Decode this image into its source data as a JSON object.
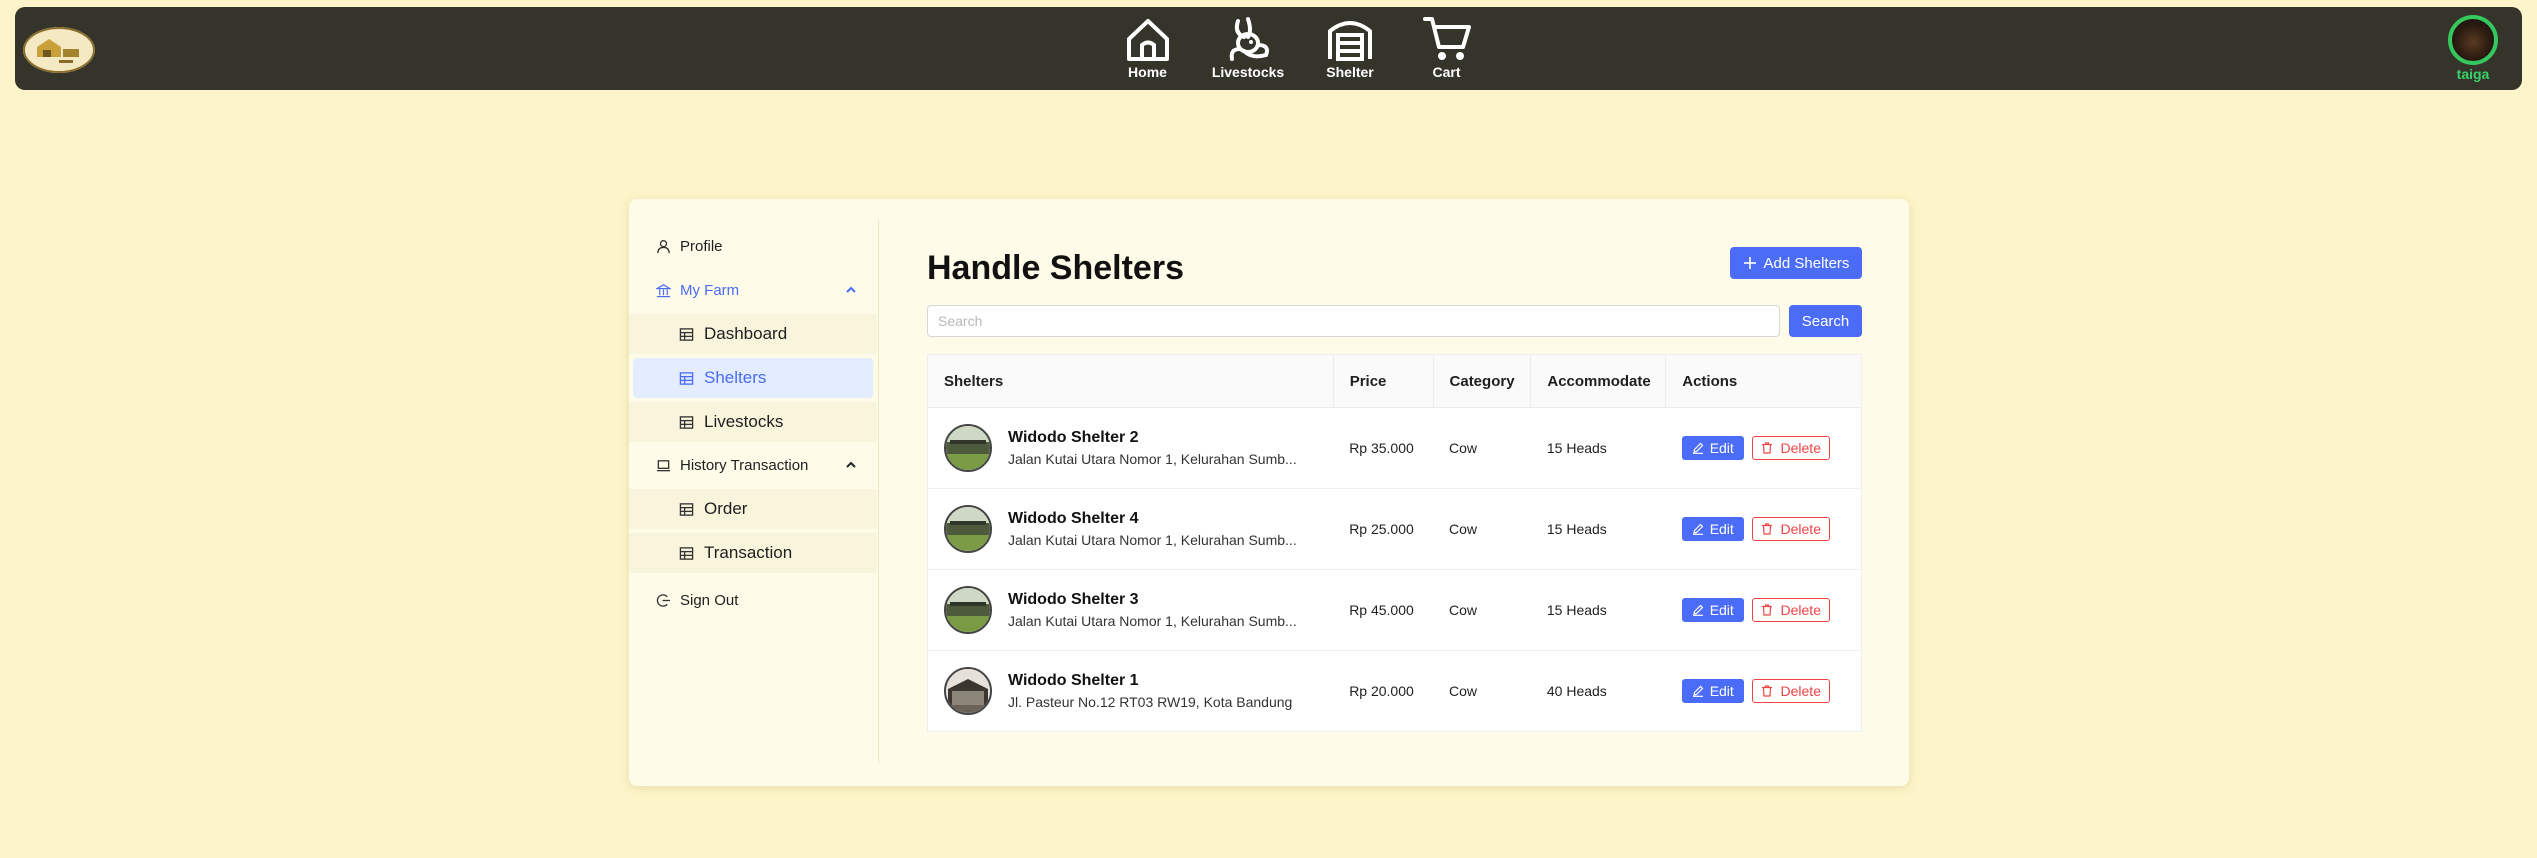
{
  "nav": {
    "logo_icon": "farm-logo",
    "items": [
      {
        "label": "Home",
        "icon": "home-icon"
      },
      {
        "label": "Livestocks",
        "icon": "rabbit-icon"
      },
      {
        "label": "Shelter",
        "icon": "warehouse-icon"
      },
      {
        "label": "Cart",
        "icon": "cart-icon"
      }
    ],
    "user": {
      "name": "taiga",
      "ring_color": "#35c85e"
    }
  },
  "sidebar": {
    "profile": "Profile",
    "my_farm": "My Farm",
    "my_farm_items": [
      "Dashboard",
      "Shelters",
      "Livestocks"
    ],
    "history": "History Transaction",
    "history_items": [
      "Order",
      "Transaction"
    ],
    "sign_out": "Sign Out",
    "active_item": "Shelters"
  },
  "main": {
    "title": "Handle Shelters",
    "add_button": "Add Shelters",
    "search_placeholder": "Search",
    "search_value": "",
    "search_button": "Search",
    "columns": [
      "Shelters",
      "Price",
      "Category",
      "Accommodate",
      "Actions"
    ],
    "rows": [
      {
        "name": "Widodo Shelter 2",
        "address": "Jalan Kutai Utara Nomor 1, Kelurahan Sumb...",
        "price": "Rp 35.000",
        "category": "Cow",
        "accommodate": "15 Heads"
      },
      {
        "name": "Widodo Shelter 4",
        "address": "Jalan Kutai Utara Nomor 1, Kelurahan Sumb...",
        "price": "Rp 25.000",
        "category": "Cow",
        "accommodate": "15 Heads"
      },
      {
        "name": "Widodo Shelter 3",
        "address": "Jalan Kutai Utara Nomor 1, Kelurahan Sumb...",
        "price": "Rp 45.000",
        "category": "Cow",
        "accommodate": "15 Heads"
      },
      {
        "name": "Widodo Shelter 1",
        "address": "Jl. Pasteur No.12 RT03 RW19, Kota Bandung",
        "price": "Rp 20.000",
        "category": "Cow",
        "accommodate": "40 Heads"
      }
    ],
    "edit_label": "Edit",
    "delete_label": "Delete"
  },
  "colors": {
    "accent": "#4b6cf6",
    "danger": "#ef4444",
    "navbar": "#35342a",
    "background": "#fdf5c9"
  }
}
